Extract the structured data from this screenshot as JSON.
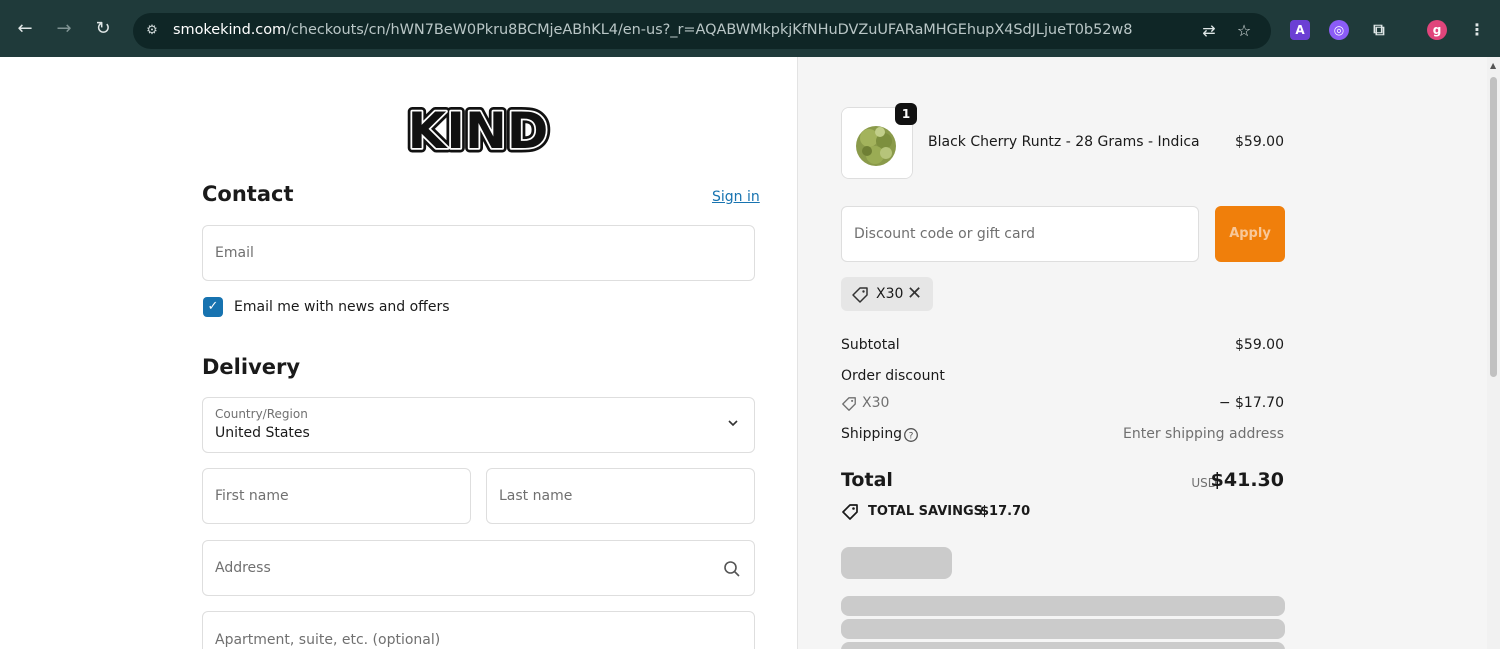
{
  "browser": {
    "url_domain": "smokekind.com",
    "url_path": "/checkouts/cn/hWN7BeW0Pkru8BCMjeABhKL4/en-us?_r=AQABWMkpkjKfNHuDVZuUFARaMHGEhupX4SdJLjueT0b52w8",
    "profile_initial": "g",
    "ext_a_label": "A"
  },
  "logo_text": "KIND",
  "contact": {
    "title": "Contact",
    "sign_in": "Sign in",
    "email_placeholder": "Email",
    "newsletter_label": "Email me with news and offers",
    "newsletter_checked": true
  },
  "delivery": {
    "title": "Delivery",
    "country_label": "Country/Region",
    "country_value": "United States",
    "first_name_placeholder": "First name",
    "last_name_placeholder": "Last name",
    "address_placeholder": "Address",
    "apartment_placeholder": "Apartment, suite, etc. (optional)"
  },
  "cart": {
    "item": {
      "name": "Black Cherry Runtz - 28 Grams - Indica",
      "price": "$59.00",
      "quantity": "1"
    },
    "discount_placeholder": "Discount code or gift card",
    "apply_label": "Apply",
    "applied_code": "X30"
  },
  "summary": {
    "subtotal_label": "Subtotal",
    "subtotal_value": "$59.00",
    "order_discount_label": "Order discount",
    "discount_code": "X30",
    "discount_value": "− $17.70",
    "shipping_label": "Shipping",
    "shipping_value": "Enter shipping address",
    "total_label": "Total",
    "currency": "USD",
    "total_value": "$41.30",
    "savings_label": "TOTAL SAVINGS",
    "savings_value": "$17.70"
  },
  "colors": {
    "accent": "#1773b0",
    "apply_button": "#f07f0b",
    "chrome_bg": "#1f3a3a"
  }
}
